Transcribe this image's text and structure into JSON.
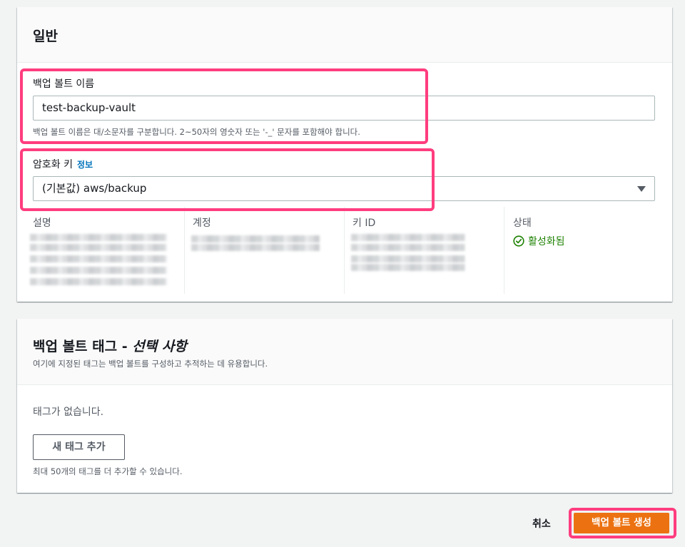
{
  "general": {
    "title": "일반",
    "vault_name": {
      "label": "백업 볼트 이름",
      "value": "test-backup-vault",
      "hint": "백업 볼트 이름은 대/소문자를 구분합니다. 2~50자의 영숫자 또는 '-_' 문자를 포함해야 합니다."
    },
    "encryption_key": {
      "label": "암호화 키",
      "info_link": "정보",
      "selected": "(기본값) aws/backup"
    },
    "key_details": {
      "columns": {
        "description": "설명",
        "account": "계정",
        "key_id": "키 ID",
        "status": "상태"
      },
      "status_value": "활성화됨"
    }
  },
  "tags": {
    "title": "백업 볼트 태그 -",
    "title_optional": "선택 사항",
    "subtitle": "여기에 지정된 태그는 백업 볼트를 구성하고 추적하는 데 유용합니다.",
    "empty_text": "태그가 없습니다.",
    "add_button": "새 태그 추가",
    "limit_hint": "최대 50개의 태그를 더 추가할 수 있습니다."
  },
  "footer": {
    "cancel": "취소",
    "create": "백업 볼트 생성"
  },
  "colors": {
    "primary_button": "#ec7211",
    "highlight": "#ff3d7f",
    "link": "#0073bb",
    "success": "#1d8102"
  }
}
